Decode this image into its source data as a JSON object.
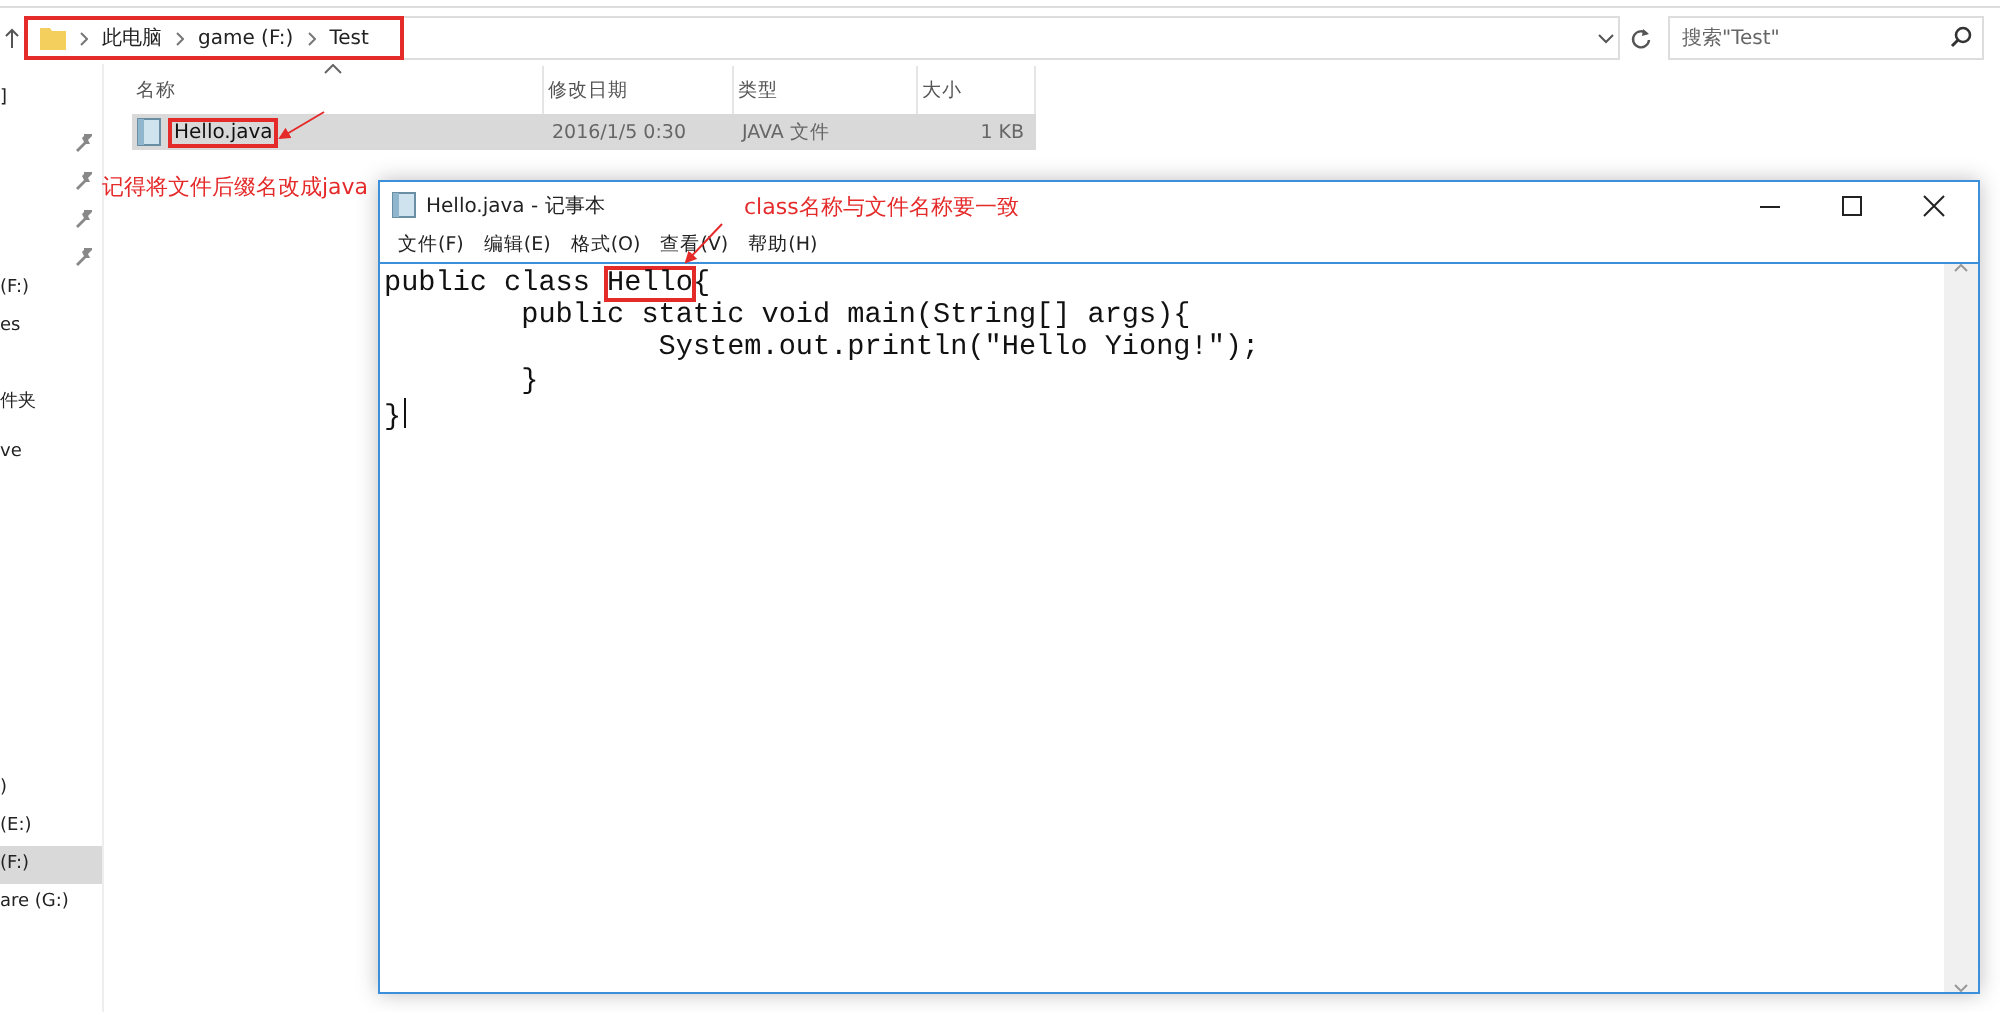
{
  "explorer": {
    "address_bar": {
      "boxed": true,
      "path": [
        "此电脑",
        "game (F:)",
        "Test"
      ]
    },
    "search": {
      "placeholder": "搜索\"Test\""
    },
    "nav_top": [
      {
        "text": "]",
        "selected": false
      }
    ],
    "nav_quick": [
      {
        "text": "(F:)",
        "selected": false
      },
      {
        "text": "es",
        "selected": false
      },
      {
        "text": "件夹",
        "selected": false
      },
      {
        "text": "ve",
        "selected": false
      }
    ],
    "nav_drives": [
      {
        "text": ")",
        "selected": false
      },
      {
        "text": "(E:)",
        "selected": false
      },
      {
        "text": "(F:)",
        "selected": true
      },
      {
        "text": "are (G:)",
        "selected": false
      }
    ],
    "columns": [
      "名称",
      "修改日期",
      "类型",
      "大小"
    ],
    "files": [
      {
        "name": "Hello.java",
        "modified": "2016/1/5 0:30",
        "type": "JAVA 文件",
        "size": "1 KB",
        "selected": true,
        "boxed": true
      }
    ]
  },
  "notepad": {
    "title": "Hello.java - 记事本",
    "menu": [
      "文件(F)",
      "编辑(E)",
      "格式(O)",
      "查看(V)",
      "帮助(H)"
    ],
    "code_lines": [
      [
        {
          "text": "public class ",
          "boxed": false
        },
        {
          "text": "Hello",
          "boxed": true
        },
        {
          "text": "{",
          "boxed": false
        }
      ],
      [
        {
          "text": "\tpublic static void main(String[] args){",
          "boxed": false
        }
      ],
      [
        {
          "text": "\t\tSystem.out.println(\"Hello Yiong!\");",
          "boxed": false
        }
      ],
      [
        {
          "text": "\t}",
          "boxed": false
        }
      ],
      [
        {
          "text": "}",
          "boxed": false
        }
      ]
    ]
  },
  "annotations": [
    {
      "text": "记得将文件后缀名改成java"
    },
    {
      "text": "class名称与文件名称要一致"
    }
  ]
}
